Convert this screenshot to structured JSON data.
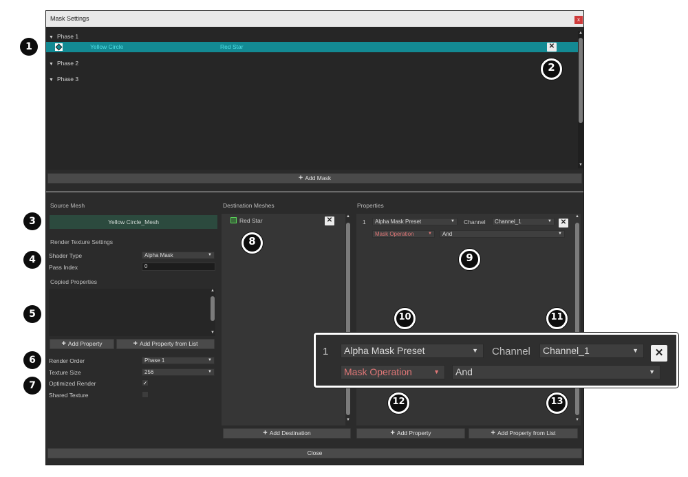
{
  "window": {
    "title": "Mask Settings",
    "close_label": "x"
  },
  "mask_list": {
    "phases": [
      {
        "label": "Phase 1"
      },
      {
        "label": "Phase 2"
      },
      {
        "label": "Phase 3"
      }
    ],
    "selected_row": {
      "source": "Yellow Circle",
      "destination": "Red Star"
    },
    "add_mask_label": "Add Mask"
  },
  "source": {
    "header": "Source Mesh",
    "mesh_name": "Yellow Circle_Mesh",
    "render_texture_header": "Render Texture Settings",
    "shader_type_label": "Shader Type",
    "shader_type_value": "Alpha Mask",
    "pass_index_label": "Pass Index",
    "pass_index_value": "0",
    "copied_properties_header": "Copied Properties",
    "add_property_label": "Add Property",
    "add_property_from_list_label": "Add Property from List",
    "render_order_label": "Render Order",
    "render_order_value": "Phase 1",
    "texture_size_label": "Texture Size",
    "texture_size_value": "256",
    "optimized_render_label": "Optimized Render",
    "optimized_render_checked": true,
    "shared_texture_label": "Shared Texture",
    "shared_texture_checked": false
  },
  "destination": {
    "header": "Destination Meshes",
    "items": [
      {
        "name": "Red Star"
      }
    ],
    "add_destination_label": "Add Destination"
  },
  "properties": {
    "header": "Properties",
    "row": {
      "index": "1",
      "preset": "Alpha Mask Preset",
      "channel_label": "Channel",
      "channel_value": "Channel_1",
      "operation": "Mask Operation",
      "operation_value": "And"
    },
    "add_property_label": "Add Property",
    "add_property_from_list_label": "Add Property from List"
  },
  "close_label": "Close",
  "callouts": [
    "1",
    "2",
    "3",
    "4",
    "5",
    "6",
    "7",
    "8",
    "9",
    "10",
    "11",
    "12",
    "13"
  ],
  "colors": {
    "selection": "#138a93",
    "selection_text": "#50e0e6",
    "source_mesh_bg": "#2c4a3e",
    "operation_red": "#e07777",
    "close_button": "#cf3b3b"
  }
}
